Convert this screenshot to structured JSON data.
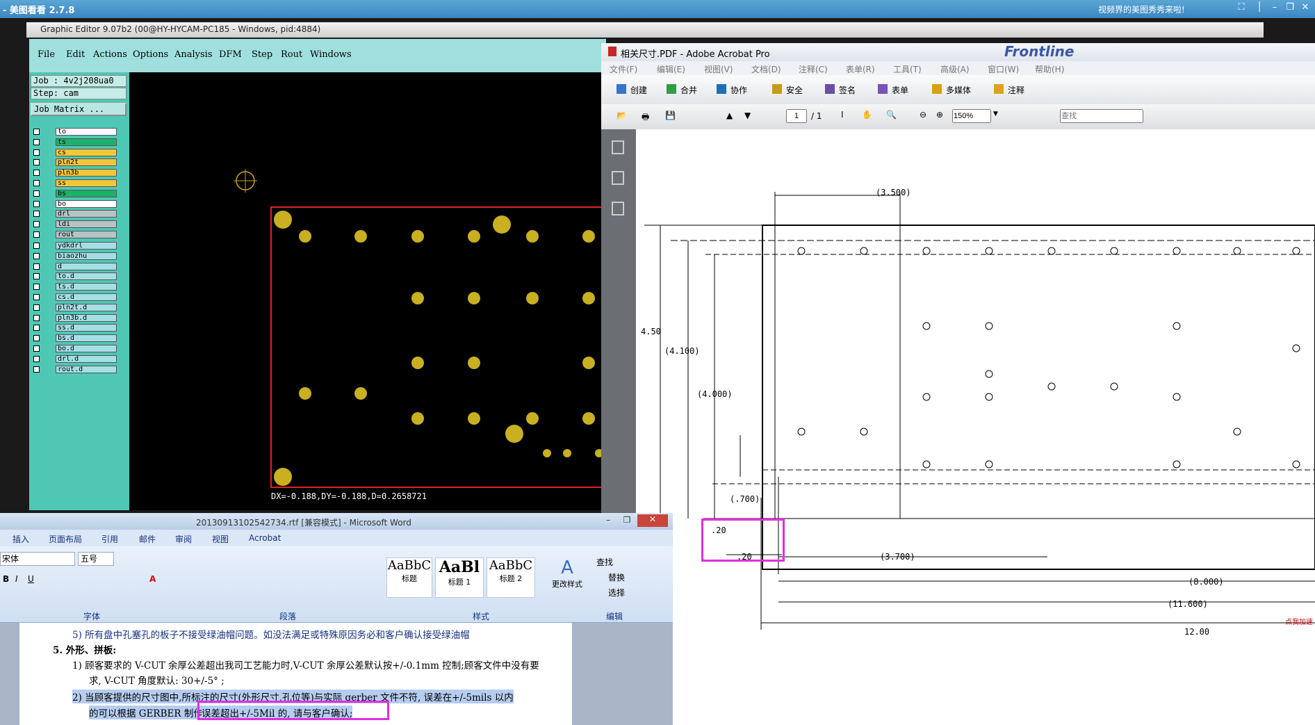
{
  "viewer": {
    "title": "- 美图看看 2.7.8",
    "promo": "视频界的美图秀秀来啦!"
  },
  "graphic_editor": {
    "title": "Graphic Editor 9.07b2 (00@HY-HYCAM-PC185 - Windows, pid:4884)",
    "menu": [
      "File",
      "Edit",
      "Actions",
      "Options",
      "Analysis",
      "DFM",
      "Step",
      "Rout",
      "Windows"
    ],
    "job": "Job : 4v2j208ua0",
    "step": "Step: cam",
    "job_matrix": "Job Matrix ...",
    "layers_group1": [
      "to",
      "ts",
      "cs",
      "pln2t",
      "pln3b",
      "ss",
      "bs",
      "bo"
    ],
    "layers_group2": [
      "drl",
      "ldi",
      "rout"
    ],
    "layers_group3": [
      "ydkdrl",
      "biaozhu",
      "d",
      "to.d",
      "ts.d",
      "cs.d",
      "pln2t.d",
      "pln3b.d",
      "ss.d",
      "bs.d",
      "bo.d",
      "drl.d",
      "rout.d"
    ],
    "coord_readout": "DX=-0.188,DY=-0.188,D=0.2658721"
  },
  "acrobat": {
    "title": "相关尺寸.PDF - Adobe Acrobat Pro",
    "menu": [
      "文件(F)",
      "编辑(E)",
      "视图(V)",
      "文档(D)",
      "注释(C)",
      "表单(R)",
      "工具(T)",
      "高级(A)",
      "窗口(W)",
      "帮助(H)"
    ],
    "toolbar": [
      "创建",
      "合并",
      "协作",
      "安全",
      "签名",
      "表单",
      "多媒体",
      "注释"
    ],
    "page_current": "1",
    "page_total": "/ 1",
    "zoom": "150%",
    "find_placeholder": "查找",
    "background_text": "Frontline",
    "dimensions": {
      "d3500": "(3.500)",
      "d450": "4.50",
      "d4100": "(4.100)",
      "d4000": "(4.000)",
      "d700": "(.700)",
      "d20a": ".20",
      "d20b": ".20",
      "d3700": "(3.700)",
      "d8000": "(8.000)",
      "d11600": "(11.600)",
      "d1200": "12.00"
    },
    "side_promo": "点我加速"
  },
  "word": {
    "title": "20130913102542734.rtf [兼容模式] - Microsoft Word",
    "tabs": [
      "插入",
      "页面布局",
      "引用",
      "邮件",
      "审阅",
      "视图",
      "Acrobat"
    ],
    "font_name": "宋体",
    "font_size": "五号",
    "styles": [
      {
        "preview": "AaBbC",
        "label": "标题"
      },
      {
        "preview": "AaBl",
        "label": "标题 1"
      },
      {
        "preview": "AaBbC",
        "label": "标题 2"
      }
    ],
    "change_styles": "更改样式",
    "edit": [
      "查找",
      "替换",
      "选择"
    ],
    "group_labels": [
      "字体",
      "段落",
      "样式",
      "编辑"
    ],
    "doc": {
      "line1": "5)  所有盘中孔塞孔的板子不接受绿油帽问题。如没法满足或特殊原因务必和客户确认接受绿油帽",
      "heading": "5.   外形、拼板:",
      "line3": "1)   顾客要求的 V-CUT 余厚公差超出我司工艺能力时,V-CUT 余厚公差默认按+/-0.1mm 控制;顾客文件中没有要",
      "line4": "求, V-CUT 角度默认: 30+/-5° ;",
      "line5": "2)   当顾客提供的尺寸图中,所标注的尺寸(外形尺寸,孔位等)与实际 gerber 文件不符, 误差在+/-5mils 以内",
      "line6a": "的可以根据 GERBER 制作,",
      "line6b": "误差超出+/-5Mil 的, 请与客户确认;"
    }
  }
}
